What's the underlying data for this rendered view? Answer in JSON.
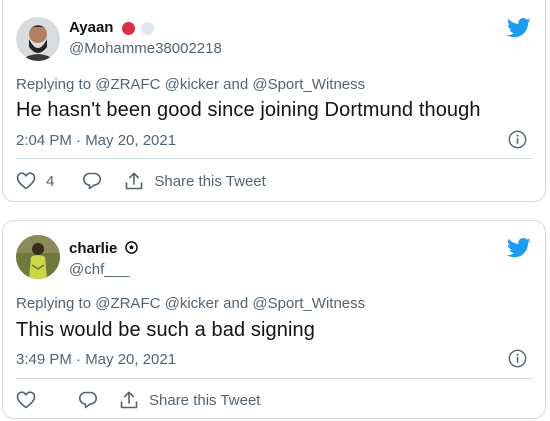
{
  "colors": {
    "twitter_blue": "#1d9bf0",
    "text_primary": "#0f1419",
    "text_secondary": "#536471",
    "border": "#cfd9de",
    "red_circle": "#dd2e44",
    "grey_circle": "#e1e8ed"
  },
  "tweets": [
    {
      "name": "Ayaan",
      "name_emoji": [
        "red-circle",
        "white-circle"
      ],
      "handle": "@Mohamme38002218",
      "replying_to": "Replying to @ZRAFC @kicker and @Sport_Witness",
      "text": "He hasn't been good since joining Dortmund though",
      "timestamp": "2:04 PM · May 20, 2021",
      "like_count": "4",
      "share_label": "Share this Tweet",
      "icons": [
        "twitter-bird-icon",
        "info-icon",
        "heart-icon",
        "comment-icon",
        "share-icon"
      ]
    },
    {
      "name": "charlie",
      "name_emoji": [
        "football-emoji"
      ],
      "handle": "@chf___",
      "replying_to": "Replying to @ZRAFC @kicker and @Sport_Witness",
      "text": "This would be such a bad signing",
      "timestamp": "3:49 PM · May 20, 2021",
      "like_count": "",
      "share_label": "Share this Tweet",
      "icons": [
        "twitter-bird-icon",
        "info-icon",
        "heart-icon",
        "comment-icon",
        "share-icon"
      ]
    }
  ]
}
